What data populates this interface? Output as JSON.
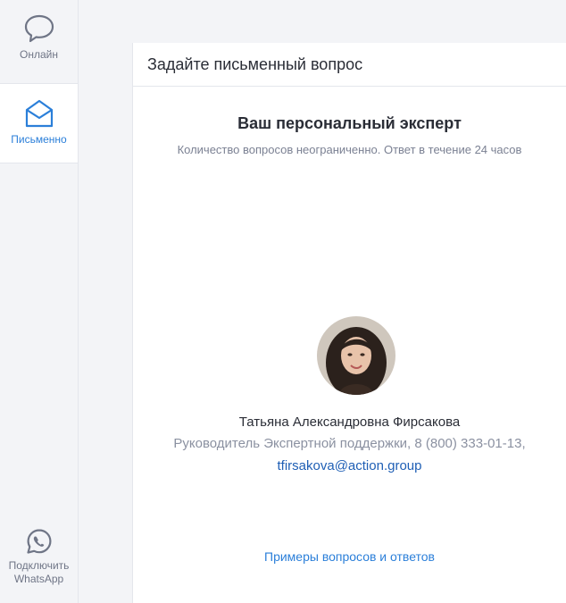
{
  "sidebar": {
    "items": [
      {
        "label": "Онлайн",
        "icon": "chat-bubble-icon"
      },
      {
        "label": "Письменно",
        "icon": "envelope-icon"
      }
    ],
    "whatsapp": {
      "label_line1": "Подключить",
      "label_line2": "WhatsApp",
      "icon": "whatsapp-icon"
    }
  },
  "panel": {
    "header": "Задайте письменный вопрос",
    "title": "Ваш персональный эксперт",
    "subtitle": "Количество вопросов неограниченно. Ответ в течение 24 часов",
    "expert": {
      "name": "Татьяна Александровна Фирсакова",
      "role": "Руководитель Экспертной поддержки, 8 (800) 333-01-13,",
      "email": "tfirsakova@action.group"
    },
    "examples_link": "Примеры вопросов и ответов"
  },
  "colors": {
    "accent": "#2b7fd9",
    "link_dark": "#1f5fb5",
    "sidebar_bg": "#f3f4f7",
    "text_muted": "#8b91a1"
  }
}
